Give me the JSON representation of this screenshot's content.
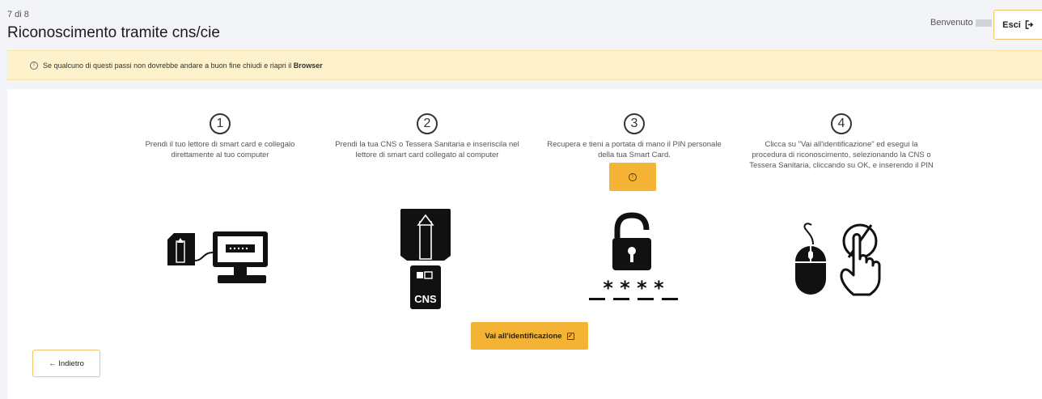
{
  "header": {
    "step_counter": "7 di 8",
    "title": "Riconoscimento tramite cns/cie",
    "welcome_label": "Benvenuto",
    "welcome_suffix": "!",
    "exit_label": "Esci"
  },
  "alert": {
    "text": "Se qualcuno di questi passi non dovrebbe andare a buon fine chiudi e riapri il",
    "bold": "Browser"
  },
  "steps": [
    {
      "number": "1",
      "description": "Prendi il tuo lettore di smart card e collegalo direttamente al tuo computer"
    },
    {
      "number": "2",
      "description": "Prendi la tua CNS o Tessera Sanitaria e inseriscila nel lettore di smart card collegato al computer"
    },
    {
      "number": "3",
      "description": "Recupera e tieni a portata di mano il PIN personale della tua Smart Card."
    },
    {
      "number": "4",
      "description": "Clicca su \"Vai all'identificazione\" ed esegui la procedura di riconoscimento, selezionando la CNS o Tessera Sanitaria, cliccando su OK, e inserendo il PIN"
    }
  ],
  "card_label": "CNS",
  "pin_stars": "* * * *",
  "buttons": {
    "identify": "Vai all'identificazione",
    "back": "← Indietro"
  },
  "icons": {
    "alert": "info-icon",
    "exit": "logout-icon",
    "pin_button": "info-icon",
    "identify": "checkbox-icon"
  },
  "colors": {
    "accent": "#f5b336",
    "alert_bg": "#fdf2cc",
    "outline": "#f2c26b"
  }
}
